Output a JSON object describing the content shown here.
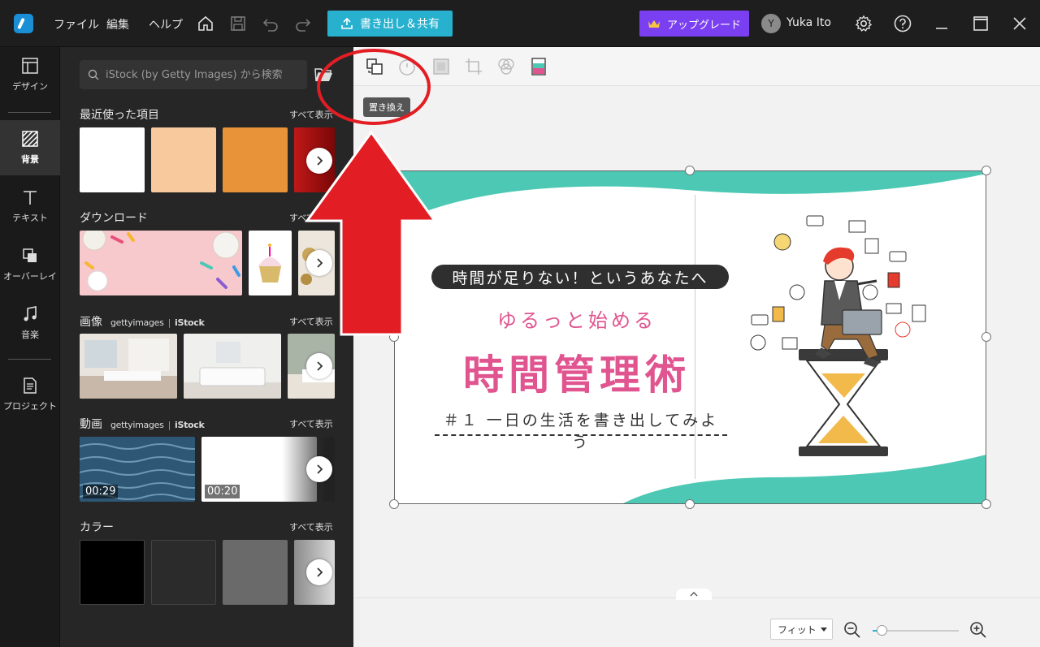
{
  "titlebar": {
    "menus": [
      "ファイル",
      "編集",
      "ヘルプ"
    ],
    "export_label": "書き出し＆共有",
    "upgrade_label": "アップグレード",
    "avatar_initial": "Y",
    "username": "Yuka Ito"
  },
  "sidebar": {
    "items": [
      {
        "label": "デザイン",
        "icon": "layout-icon"
      },
      {
        "label": "背景",
        "icon": "background-pattern-icon"
      },
      {
        "label": "テキスト",
        "icon": "text-icon"
      },
      {
        "label": "オーバーレイ",
        "icon": "overlay-icon"
      },
      {
        "label": "音楽",
        "icon": "music-icon"
      },
      {
        "label": "プロジェクト",
        "icon": "document-icon"
      }
    ]
  },
  "panel": {
    "search_placeholder": "iStock (by Getty Images) から検索",
    "see_all": "すべて表示",
    "sections": {
      "recent": "最近使った項目",
      "download": "ダウンロード",
      "image": "画像",
      "video": "動画",
      "color": "カラー"
    },
    "brand_getty": "gettyimages",
    "brand_sep": "|",
    "brand_istock": "iStock",
    "video_durations": [
      "00:29",
      "00:20"
    ],
    "colors": {
      "recent": [
        "#ffffff",
        "#f7c99c",
        "#e8923a",
        "#b01010"
      ],
      "color_swatches": [
        "#000000",
        "#2b2b2b",
        "#6a6a6a",
        "#bdbdbd"
      ]
    }
  },
  "toolbar": {
    "tooltip": "置き換え"
  },
  "canvas": {
    "pill_text": "時間が足りない！というあなたへ",
    "subtitle": "ゆるっと始める",
    "title": "時間管理術",
    "line": "＃１ 一日の生活を書き出してみよう",
    "colors": {
      "teal": "#4cc8b4",
      "pink": "#e0558f"
    }
  },
  "bottombar": {
    "zoom_mode": "フィット",
    "zoom_level": 0.1
  },
  "colors": {
    "accent": "#27b1cf",
    "upgrade": "#7b3ff2",
    "annotation": "#e21d24"
  }
}
